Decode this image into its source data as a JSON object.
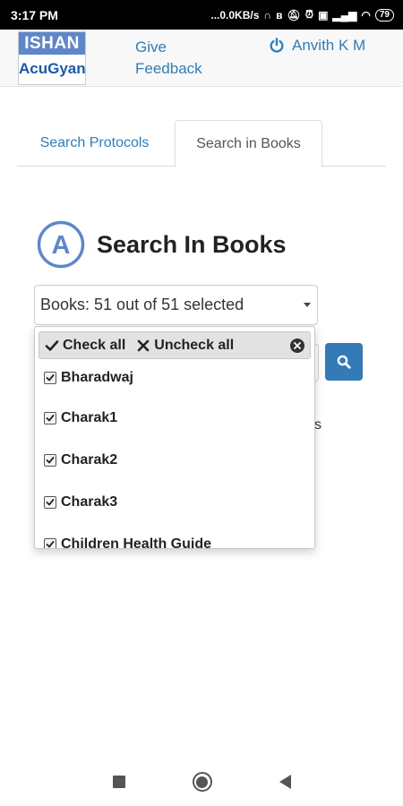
{
  "status_bar": {
    "time": "3:17 PM",
    "network_speed": "...0.0KB/s",
    "battery": "79"
  },
  "header": {
    "logo_top": "ISHAN",
    "logo_bottom": "AcuGyan",
    "feedback_label": "Give Feedback",
    "user_name": "Anvith K M",
    "accent_color": "#2f7db9"
  },
  "tabs": [
    {
      "label": "Search Protocols",
      "active": false
    },
    {
      "label": "Search in Books",
      "active": true
    }
  ],
  "page": {
    "title": "Search In Books",
    "title_icon_letter": "A"
  },
  "books_select": {
    "summary": "Books: 51 out of 51 selected",
    "check_all_label": "Check all",
    "uncheck_all_label": "Uncheck all",
    "items": [
      {
        "label": "Bharadwaj",
        "checked": true
      },
      {
        "label": "Charak1",
        "checked": true
      },
      {
        "label": "Charak2",
        "checked": true
      },
      {
        "label": "Charak3",
        "checked": true
      },
      {
        "label": "Children Health Guide",
        "checked": true
      }
    ]
  },
  "background": {
    "partial_text": "s"
  },
  "icons": [
    "power-icon",
    "search-icon",
    "check-icon",
    "times-icon",
    "close-circle-icon",
    "chevron-down-icon"
  ]
}
